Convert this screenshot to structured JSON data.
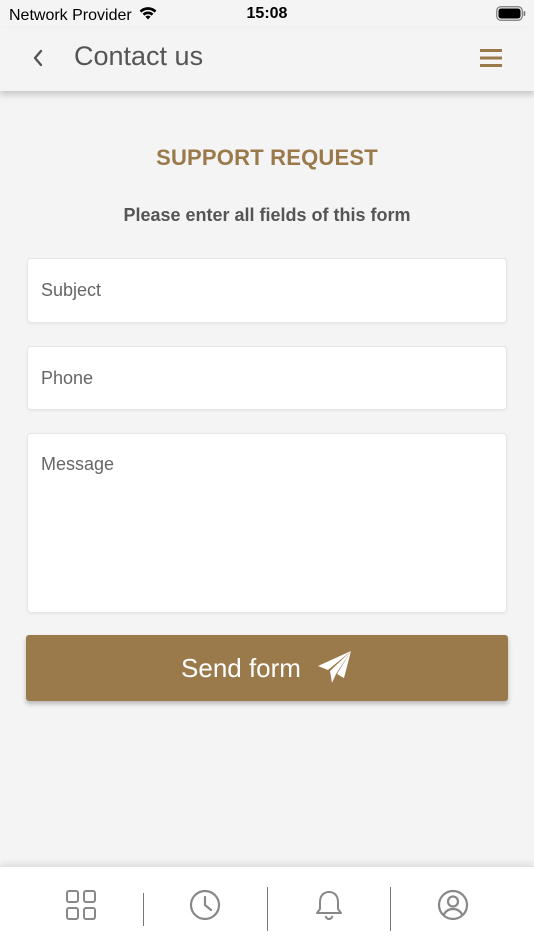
{
  "status_bar": {
    "carrier": "Network Provider",
    "time": "15:08",
    "wifi_icon": "wifi-icon",
    "battery_icon": "battery-icon"
  },
  "nav_bar": {
    "title": "Contact us",
    "back_icon": "chevron-left-icon",
    "menu_icon": "hamburger-menu-icon"
  },
  "form": {
    "title": "SUPPORT REQUEST",
    "subtitle": "Please enter all fields of this form",
    "subject": {
      "placeholder": "Subject",
      "value": ""
    },
    "phone": {
      "placeholder": "Phone",
      "value": ""
    },
    "message": {
      "placeholder": "Message",
      "value": ""
    },
    "send_label": "Send form",
    "send_icon": "paper-plane-icon"
  },
  "tab_bar": {
    "tabs": [
      {
        "icon": "grid-icon"
      },
      {
        "icon": "clock-icon"
      },
      {
        "icon": "bell-icon"
      },
      {
        "icon": "user-circle-icon"
      }
    ]
  },
  "colors": {
    "accent": "#9a7a4b",
    "background": "#f4f4f4",
    "icon_gray": "#888888"
  }
}
